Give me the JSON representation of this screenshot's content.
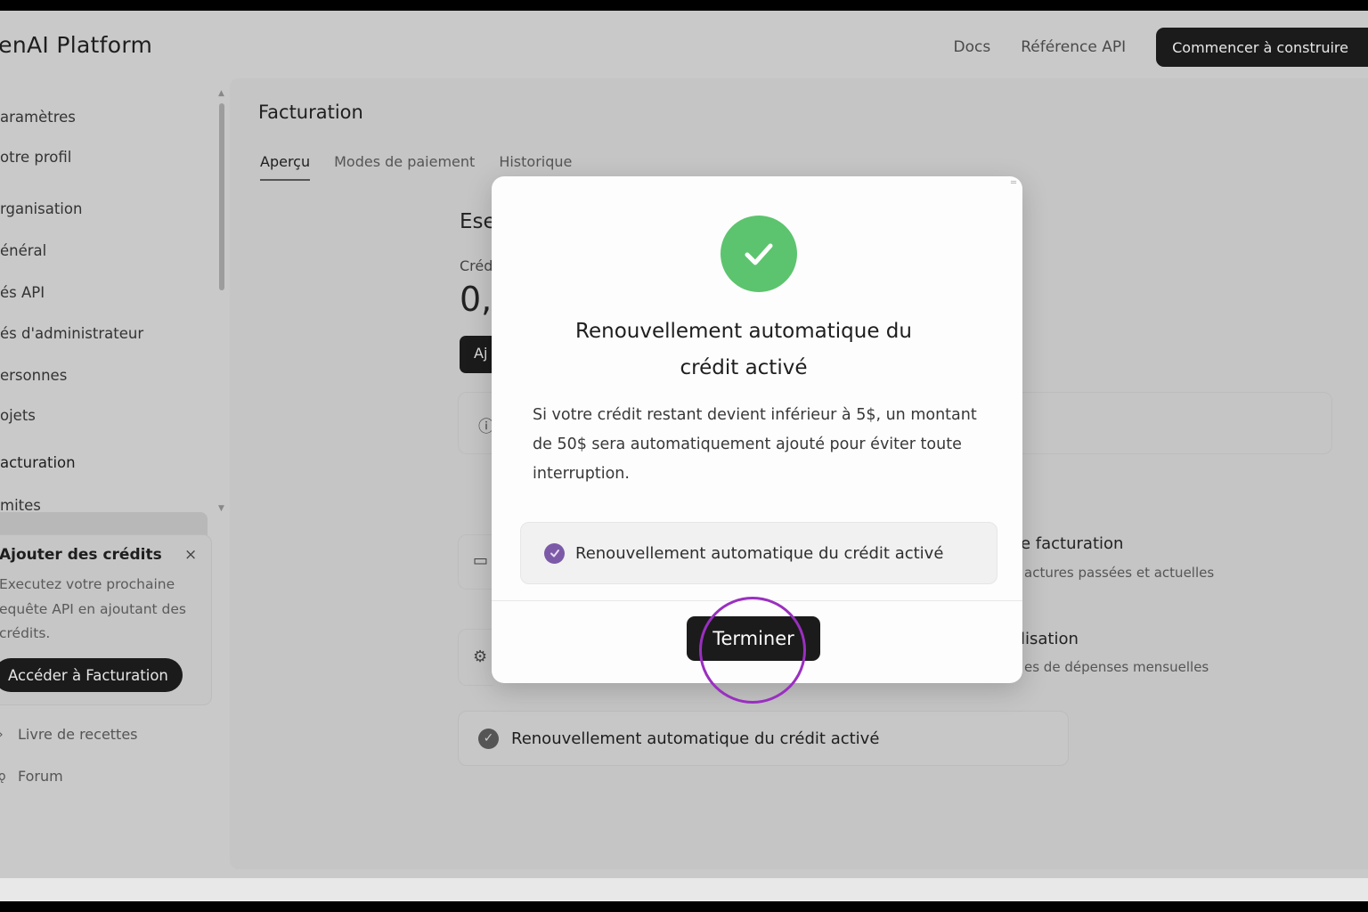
{
  "header": {
    "brand": "penAI  Platform",
    "nav_docs": "Docs",
    "nav_api_ref": "Référence API",
    "cta": "Commencer à construire"
  },
  "sidebar": {
    "items": [
      {
        "label": "aramètres"
      },
      {
        "label": "otre profil"
      },
      {
        "label": "rganisation"
      },
      {
        "label": "énéral"
      },
      {
        "label": "és API"
      },
      {
        "label": "és d'administrateur"
      },
      {
        "label": "ersonnes"
      },
      {
        "label": "ojets"
      },
      {
        "label": "acturation"
      },
      {
        "label": "mites"
      }
    ],
    "promo": {
      "title": "Ajouter des crédits",
      "close": "×",
      "text": "Executez votre prochaine equête API en ajoutant des crédits.",
      "button": "Accéder à Facturation"
    },
    "links": [
      {
        "label": "Livre de recettes",
        "icon": "cookbook-icon"
      },
      {
        "label": "Forum",
        "icon": "forum-icon"
      }
    ]
  },
  "main": {
    "title": "Facturation",
    "tabs": [
      {
        "label": "Aperçu",
        "active": true
      },
      {
        "label": "Modes de paiement"
      },
      {
        "label": "Historique"
      }
    ],
    "bg": {
      "heading_fragment": "Ese",
      "credit_label_fragment": "Créd",
      "credit_value_fragment": "0,",
      "add_btn_fragment": "Aj",
      "billing_title_fragment": "e facturation",
      "billing_sub_fragment": "actures passées et actuelles",
      "usage_title_fragment": "lisation",
      "usage_sub_fragment": "es de dépenses mensuelles"
    },
    "status_bar": "Renouvellement automatique du crédit activé"
  },
  "modal": {
    "title": "Renouvellement automatique du crédit activé",
    "body": "Si votre crédit restant devient inférieur à 5$, un montant de 50$ sera automatiquement ajouté pour éviter toute interruption.",
    "status": "Renouvellement automatique du crédit activé",
    "button": "Terminer"
  },
  "colors": {
    "success": "#5cc46e",
    "check_purple": "#7c5aa8",
    "click_ring": "#9a2fc0",
    "dark": "#1b1b1b"
  }
}
